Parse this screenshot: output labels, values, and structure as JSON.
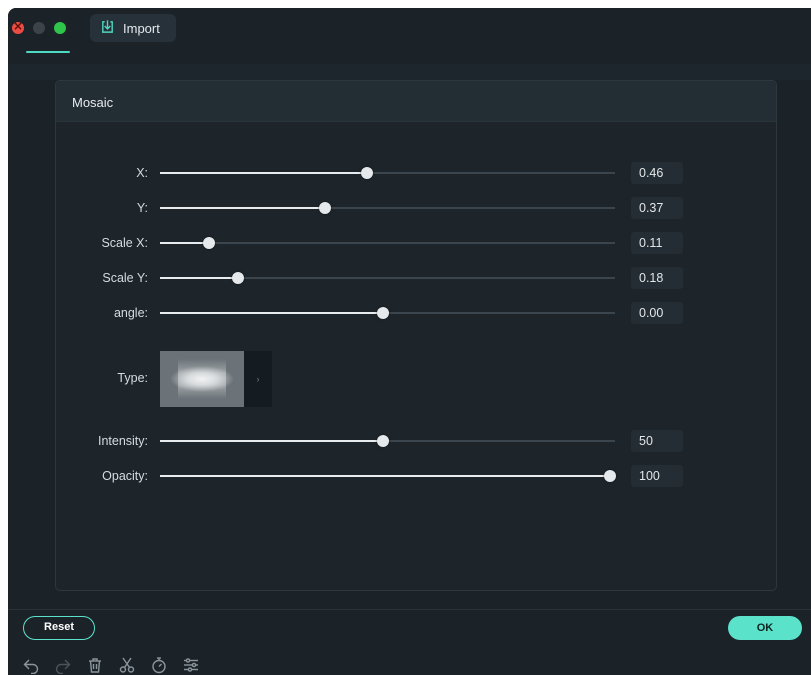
{
  "titlebar": {
    "import_label": "Import",
    "import_icon": "import-icon"
  },
  "panel": {
    "title": "Mosaic",
    "sliders": [
      {
        "key": "x",
        "label": "X:",
        "value": "0.46",
        "fraction": 0.455
      },
      {
        "key": "y",
        "label": "Y:",
        "value": "0.37",
        "fraction": 0.362
      },
      {
        "key": "scale-x",
        "label": "Scale X:",
        "value": "0.11",
        "fraction": 0.108
      },
      {
        "key": "scale-y",
        "label": "Scale Y:",
        "value": "0.18",
        "fraction": 0.172
      },
      {
        "key": "angle",
        "label": "angle:",
        "value": "0.00",
        "fraction": 0.49
      }
    ],
    "type": {
      "label": "Type:",
      "arrow": "›"
    },
    "sliders2": [
      {
        "key": "intensity",
        "label": "Intensity:",
        "value": "50",
        "fraction": 0.49
      },
      {
        "key": "opacity",
        "label": "Opacity:",
        "value": "100",
        "fraction": 0.99
      }
    ]
  },
  "footer": {
    "reset_label": "Reset",
    "ok_label": "OK"
  },
  "toolbar": {
    "tools": [
      "undo-icon",
      "redo-icon",
      "trash-icon",
      "scissors-icon",
      "timer-icon",
      "adjust-icon"
    ]
  },
  "colors": {
    "accent": "#5be2cb",
    "window_bg": "#1b2329",
    "close": "#ed4c43",
    "maximize": "#2fc44a"
  }
}
